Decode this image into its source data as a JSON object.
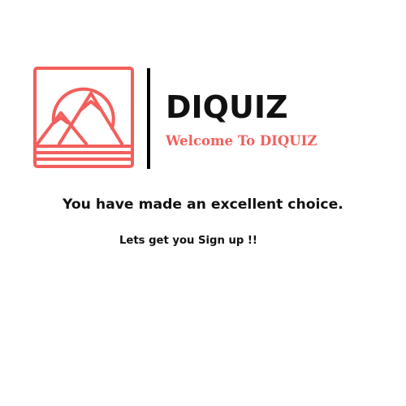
{
  "brand": {
    "name": "DIQUIZ",
    "tagline": "Welcome To DIQUIZ",
    "logo_icon": "mountain-sun-logo-icon"
  },
  "message": {
    "headline": "You have made an excellent choice.",
    "subline": "Lets get you Sign up !!"
  },
  "colors": {
    "accent": "#f25f5c",
    "text": "#111111",
    "background": "#ffffff"
  }
}
